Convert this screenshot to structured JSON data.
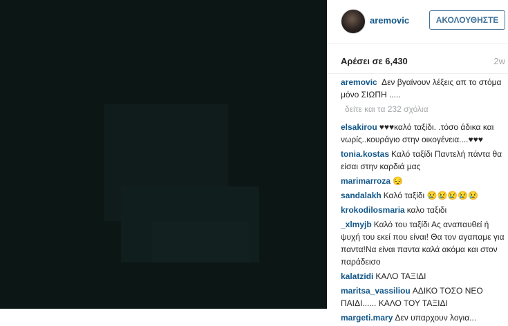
{
  "post": {
    "username": "aremovic",
    "follow_label": "ΑΚΟΛΟΥΘΗΣΤΕ",
    "likes_text": "Αρέσει σε 6,430",
    "age": "2w",
    "caption": {
      "user": "aremovic",
      "text": "Δεν βγαίνουν λέξεις απ το στόμα μόνο ΣΙΩΠΗ ....."
    },
    "view_all": "δείτε και τα 232 σχόλια"
  },
  "comments": [
    {
      "user": "elsakirou",
      "text": "♥♥♥καλό ταξίδι. .τόσο άδικα και νωρίς..κουράγιο στην οικογένεια....♥♥♥"
    },
    {
      "user": "tonia.kostas",
      "text": "Καλό ταξίδι Παντελή πάντα θα είσαι στην καρδιά μας"
    },
    {
      "user": "marimarroza",
      "text": "😔"
    },
    {
      "user": "sandalakh",
      "text": "Καλό ταξίδι 😢😢😢😢😢"
    },
    {
      "user": "krokodilosmaria",
      "text": "καλο ταξιδι"
    },
    {
      "user": "_xlmyjb",
      "text": "Καλό του ταξίδι Ας αναπαυθεί ή ψυχή του εκεί που είναι! Θα τον αγαπαμε για παντα!Να είναι παντα καλά ακόμα και στον παράδεισο"
    },
    {
      "user": "kalatzidi",
      "text": "ΚΑΛΟ ΤΑΞΙΔΙ"
    },
    {
      "user": "maritsa_vassiliou",
      "text": "ΑΔΙΚΟ ΤΟΣΟ ΝΕΟ ΠΑΙΔΙ...... ΚΑΛΟ ΤΟΥ ΤΑΞΙΔΙ"
    },
    {
      "user": "margeti.mary",
      "text": "Δεν υπαρχουν λογια..."
    }
  ]
}
